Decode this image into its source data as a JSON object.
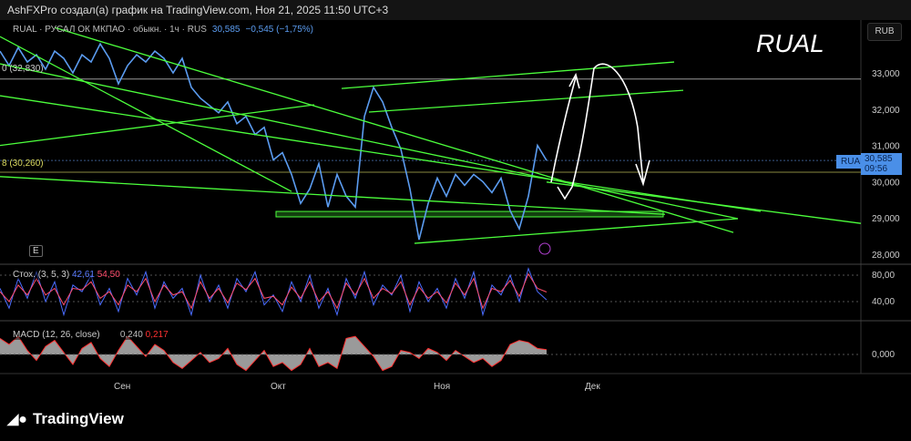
{
  "header": {
    "attribution": "AshFXPro создал(а) график на TradingView.com, Ноя 21, 2025 11:50 UTC+3"
  },
  "legend": {
    "symbol": "RUAL · РУСАЛ ОК МКПАО · обыкн. · 1ч · RUS",
    "price": "30,585",
    "change": "−0,545 (−1,75%)"
  },
  "chart_title": "RUAL",
  "currency": "RUB",
  "price_tag": {
    "symbol": "RUAL",
    "price": "30,585",
    "countdown": "09:56"
  },
  "left_labels": {
    "level1": "0 (32,830)",
    "level2": "8 (30,260)",
    "e_button": "E"
  },
  "stoch": {
    "label": "Стох. (3, 5, 3)",
    "k": "42,61",
    "d": "54,50",
    "ticks": [
      "80,00",
      "40,00"
    ]
  },
  "macd": {
    "label": "MACD (12, 26, close)",
    "macd": "0,240",
    "signal": "0,217",
    "ticks": [
      "0,000"
    ]
  },
  "footer": {
    "brand": "TradingView"
  },
  "colors": {
    "price": "#5b9cf0",
    "trend": "#4cff3c",
    "stochK": "#4a6cff",
    "stochD": "#ff4d6d",
    "macdFill": "#9a9a9a",
    "macdLine": "#ff3030"
  },
  "chart_data": {
    "type": "line",
    "title": "RUAL",
    "ylabel": "RUB",
    "ylim": [
      27900,
      33400
    ],
    "yticks": [
      "33,000",
      "32,000",
      "31,000",
      "30,000",
      "29,000",
      "28,000"
    ],
    "ytick_values": [
      33000,
      32000,
      31000,
      30000,
      29000,
      28000
    ],
    "xticks": [
      {
        "label": "Сен",
        "bar": 13.3
      },
      {
        "label": "Окт",
        "bar": 30.5
      },
      {
        "label": "Ноя",
        "bar": 48.4
      },
      {
        "label": "Дек",
        "bar": 65
      }
    ],
    "price": [
      33600,
      33200,
      33700,
      33300,
      33500,
      33100,
      33600,
      33400,
      33000,
      33500,
      33300,
      33800,
      33400,
      32700,
      33200,
      33500,
      33300,
      33600,
      33400,
      33000,
      33400,
      32600,
      32300,
      32100,
      31900,
      32200,
      31600,
      31800,
      31300,
      31500,
      30600,
      30800,
      30200,
      29400,
      29800,
      30500,
      29300,
      30200,
      29600,
      29300,
      31800,
      32600,
      32200,
      31500,
      30900,
      29800,
      28400,
      29400,
      30100,
      29600,
      30200,
      29900,
      30200,
      30000,
      29700,
      30100,
      29200,
      28700,
      29600,
      31000,
      30585
    ],
    "horizontal_levels": [
      {
        "price": 32830,
        "color": "#9a9a9a"
      },
      {
        "price": 30260,
        "color": "#8a8a40"
      },
      {
        "price": 30585,
        "color": "#3a5a8a"
      }
    ],
    "zone": {
      "from_bar": 30.3,
      "to_bar": 72.8,
      "low": 29030,
      "high": 29180
    },
    "trendlines": [
      [
        0,
        34000,
        32,
        29730
      ],
      [
        0,
        33250,
        81,
        28980
      ],
      [
        0,
        30140,
        73,
        29100
      ],
      [
        0,
        31000,
        34.5,
        32120
      ],
      [
        0,
        32370,
        83.5,
        29180
      ],
      [
        37.5,
        32570,
        74,
        33300
      ],
      [
        40.5,
        31920,
        75,
        32520
      ],
      [
        45.5,
        28300,
        81,
        28980
      ],
      [
        60,
        29990,
        94.5,
        28850
      ],
      [
        6,
        34250,
        80.5,
        28600
      ]
    ],
    "stoch_k": [
      60,
      30,
      75,
      45,
      85,
      40,
      70,
      20,
      65,
      55,
      80,
      35,
      60,
      25,
      75,
      50,
      85,
      30,
      70,
      45,
      60,
      20,
      80,
      40,
      65,
      30,
      75,
      55,
      85,
      35,
      50,
      25,
      70,
      40,
      80,
      30,
      60,
      20,
      75,
      45,
      85,
      35,
      65,
      50,
      80,
      25,
      70,
      40,
      60,
      30,
      75,
      45,
      85,
      20,
      65,
      50,
      80,
      40,
      90,
      55,
      42.61
    ],
    "stoch_d": [
      55,
      40,
      65,
      50,
      75,
      50,
      60,
      35,
      60,
      58,
      70,
      45,
      55,
      35,
      65,
      55,
      75,
      40,
      65,
      50,
      55,
      30,
      70,
      45,
      60,
      38,
      68,
      58,
      75,
      45,
      48,
      35,
      62,
      45,
      70,
      40,
      55,
      30,
      68,
      50,
      75,
      45,
      60,
      52,
      70,
      35,
      62,
      45,
      55,
      38,
      68,
      50,
      75,
      30,
      60,
      55,
      72,
      48,
      82,
      60,
      54.5
    ],
    "macd": [
      0.8,
      0.5,
      0.9,
      0.2,
      -0.3,
      0.4,
      0.7,
      0.1,
      -0.5,
      0.3,
      0.6,
      -0.2,
      -0.6,
      0.2,
      0.9,
      0.4,
      -0.1,
      0.5,
      0.2,
      -0.4,
      -0.7,
      -0.3,
      0.1,
      -0.4,
      -0.2,
      0.3,
      -0.5,
      -0.8,
      -0.3,
      0.2,
      -0.6,
      -0.4,
      -0.8,
      -0.5,
      0.3,
      -0.6,
      -0.4,
      -0.7,
      0.8,
      0.9,
      0.4,
      -0.1,
      -0.8,
      -0.6,
      0.2,
      0.1,
      -0.2,
      0.3,
      0.1,
      -0.3,
      0.2,
      -0.1,
      -0.4,
      -0.2,
      -0.6,
      -0.3,
      0.5,
      0.7,
      0.6,
      0.3,
      0.24
    ]
  }
}
